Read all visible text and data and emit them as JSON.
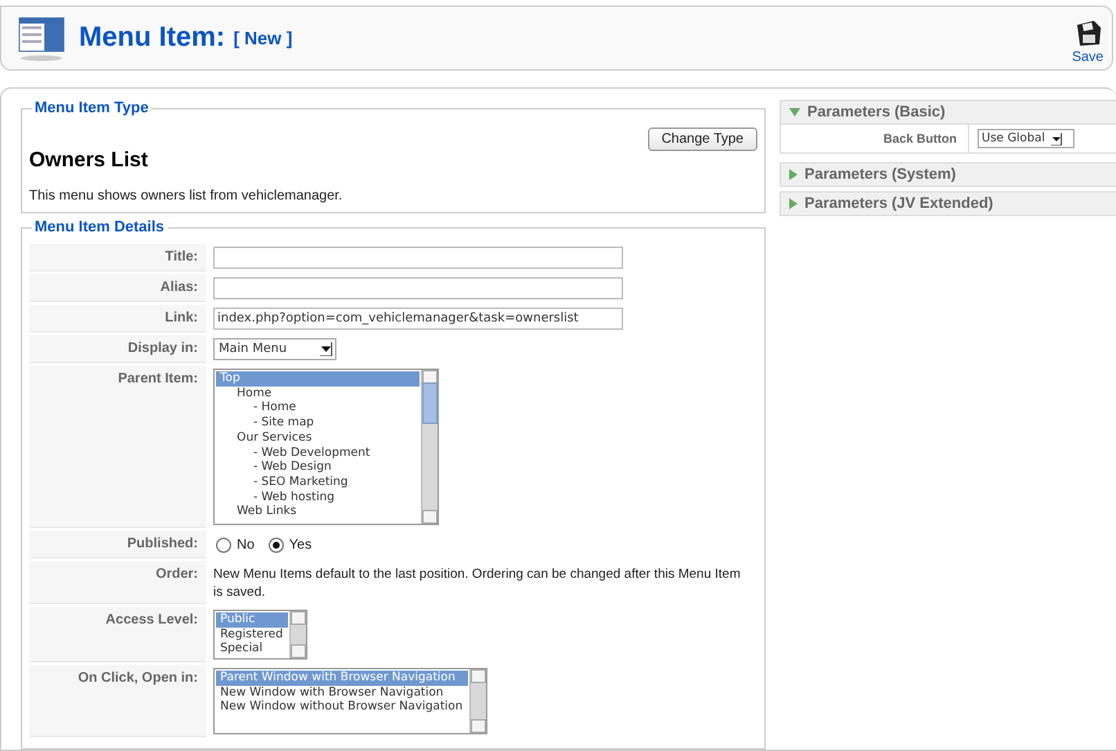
{
  "header": {
    "title": "Menu Item:",
    "subtitle": "[ New ]",
    "save_label": "Save"
  },
  "menu_item_type": {
    "legend": "Menu Item Type",
    "name": "Owners List",
    "change_button": "Change Type",
    "description": "This menu shows owners list from vehiclemanager."
  },
  "menu_item_details": {
    "legend": "Menu Item Details",
    "rows": [
      {
        "kind": "text",
        "label": "Title:"
      },
      {
        "kind": "text",
        "label": "Alias:"
      },
      {
        "kind": "text",
        "label": "Link:",
        "value": "index.php?option=com_vehiclemanager&task=ownerslist"
      },
      {
        "kind": "select",
        "label": "Display in:",
        "value": "Main Menu"
      },
      {
        "kind": "list",
        "label": "Parent Item:",
        "items": [
          {
            "label": "Top",
            "selected": true,
            "children": [
              {
                "label": "Home",
                "selected": false,
                "children": [
                  {
                    "label": "- Home",
                    "selected": false
                  },
                  {
                    "label": "- Site map",
                    "selected": false
                  }
                ]
              },
              {
                "label": "Our Services",
                "selected": false,
                "children": [
                  {
                    "label": "- Web Development",
                    "selected": false
                  },
                  {
                    "label": "- Web Design",
                    "selected": false
                  },
                  {
                    "label": "- SEO Marketing",
                    "selected": false
                  },
                  {
                    "label": "- Web hosting",
                    "selected": false
                  }
                ]
              },
              {
                "label": "Web Links",
                "selected": false
              }
            ]
          }
        ]
      },
      {
        "kind": "radio",
        "label": "Published:",
        "options": [
          {
            "label": "No",
            "selected": false
          },
          {
            "label": "Yes",
            "selected": true
          }
        ]
      },
      {
        "kind": "note",
        "label": "Order:",
        "text": "New Menu Items default to the last position. Ordering can be changed after this Menu Item is saved."
      },
      {
        "kind": "list",
        "label": "Access Level:",
        "items": [
          {
            "label": "Public",
            "selected": true
          },
          {
            "label": "Registered",
            "selected": false
          },
          {
            "label": "Special",
            "selected": false
          }
        ]
      },
      {
        "kind": "list",
        "label": "On Click, Open in:",
        "items": [
          {
            "label": "Parent Window with Browser Navigation",
            "selected": true
          },
          {
            "label": "New Window with Browser Navigation",
            "selected": false
          },
          {
            "label": "New Window without Browser Navigation",
            "selected": false
          }
        ]
      }
    ]
  },
  "parameters": [
    {
      "title": "Parameters (Basic)",
      "expanded": true,
      "rows": [
        {
          "label": "Back Button",
          "value": "Use Global"
        }
      ]
    },
    {
      "title": "Parameters (System)",
      "expanded": false
    },
    {
      "title": "Parameters (JV Extended)",
      "expanded": false
    }
  ]
}
